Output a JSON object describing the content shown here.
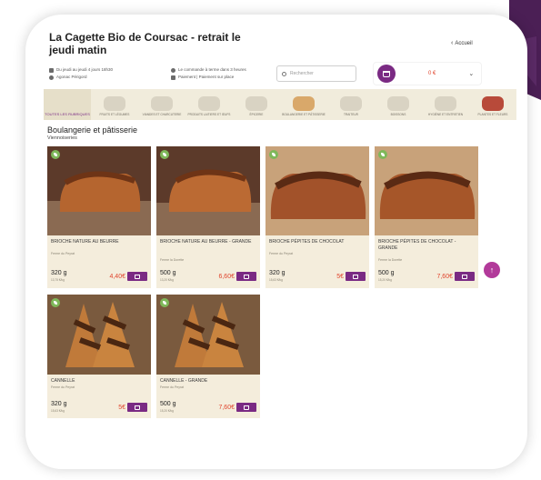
{
  "colors": {
    "brand_purple": "#7a2a83",
    "price_red": "#e0442c",
    "category_bg": "#f1ecdc",
    "card_bg": "#f4eddc",
    "bio_green": "#7fb85a"
  },
  "header": {
    "title": "La Cagette Bio de Coursac - retrait le jeudi matin",
    "back_label": "Accueil",
    "back_icon": "chevron-left-icon"
  },
  "info": {
    "line1": "Du jeudi au jeudi 4 jours 18h30",
    "line2": "Agonac Périgord",
    "line3": "Le commande à terme dans 3 heures",
    "line4": "Paiement | Paiement sur place"
  },
  "search": {
    "placeholder": "Rechercher"
  },
  "cart": {
    "total": "0 €",
    "icon": "shopping-bag-icon"
  },
  "categories": [
    {
      "label": "Toutes les rubriques",
      "active": true
    },
    {
      "label": "Fruits et légumes",
      "active": false
    },
    {
      "label": "Viandes et charcuterie",
      "active": false
    },
    {
      "label": "Produits laitiers et œufs",
      "active": false
    },
    {
      "label": "Épicerie",
      "active": false
    },
    {
      "label": "Boulangerie et pâtisserie",
      "active": false
    },
    {
      "label": "Traiteur",
      "active": false
    },
    {
      "label": "Boissons",
      "active": false
    },
    {
      "label": "Hygiène et entretien",
      "active": false
    },
    {
      "label": "Plantes et fleurs",
      "active": false
    }
  ],
  "section": {
    "title": "Boulangerie et pâtisserie",
    "subtitle": "Viennoiseries"
  },
  "products": [
    {
      "name": "Brioche nature au beurre",
      "maker": "Ferme du Peyrat",
      "weight": "320 g",
      "unit_price": "13,75 €/kg",
      "price": "4,40€"
    },
    {
      "name": "Brioche nature au beurre - grande",
      "maker": "Ferme la Dorette",
      "weight": "500 g",
      "unit_price": "13,20 €/kg",
      "price": "6,60€"
    },
    {
      "name": "Brioche pépites de chocolat",
      "maker": "Ferme du Peyrat",
      "weight": "320 g",
      "unit_price": "15,63 €/kg",
      "price": "5€"
    },
    {
      "name": "Brioche pépites de chocolat - grande",
      "maker": "Ferme la Dorette",
      "weight": "500 g",
      "unit_price": "15,20 €/kg",
      "price": "7,60€"
    },
    {
      "name": "Cannelle",
      "maker": "Ferme du Peyrat",
      "weight": "320 g",
      "unit_price": "15,63 €/kg",
      "price": "5€"
    },
    {
      "name": "Cannelle - grande",
      "maker": "Ferme du Peyrat",
      "weight": "500 g",
      "unit_price": "15,20 €/kg",
      "price": "7,60€"
    }
  ],
  "scroll_top_icon": "arrow-up-icon"
}
